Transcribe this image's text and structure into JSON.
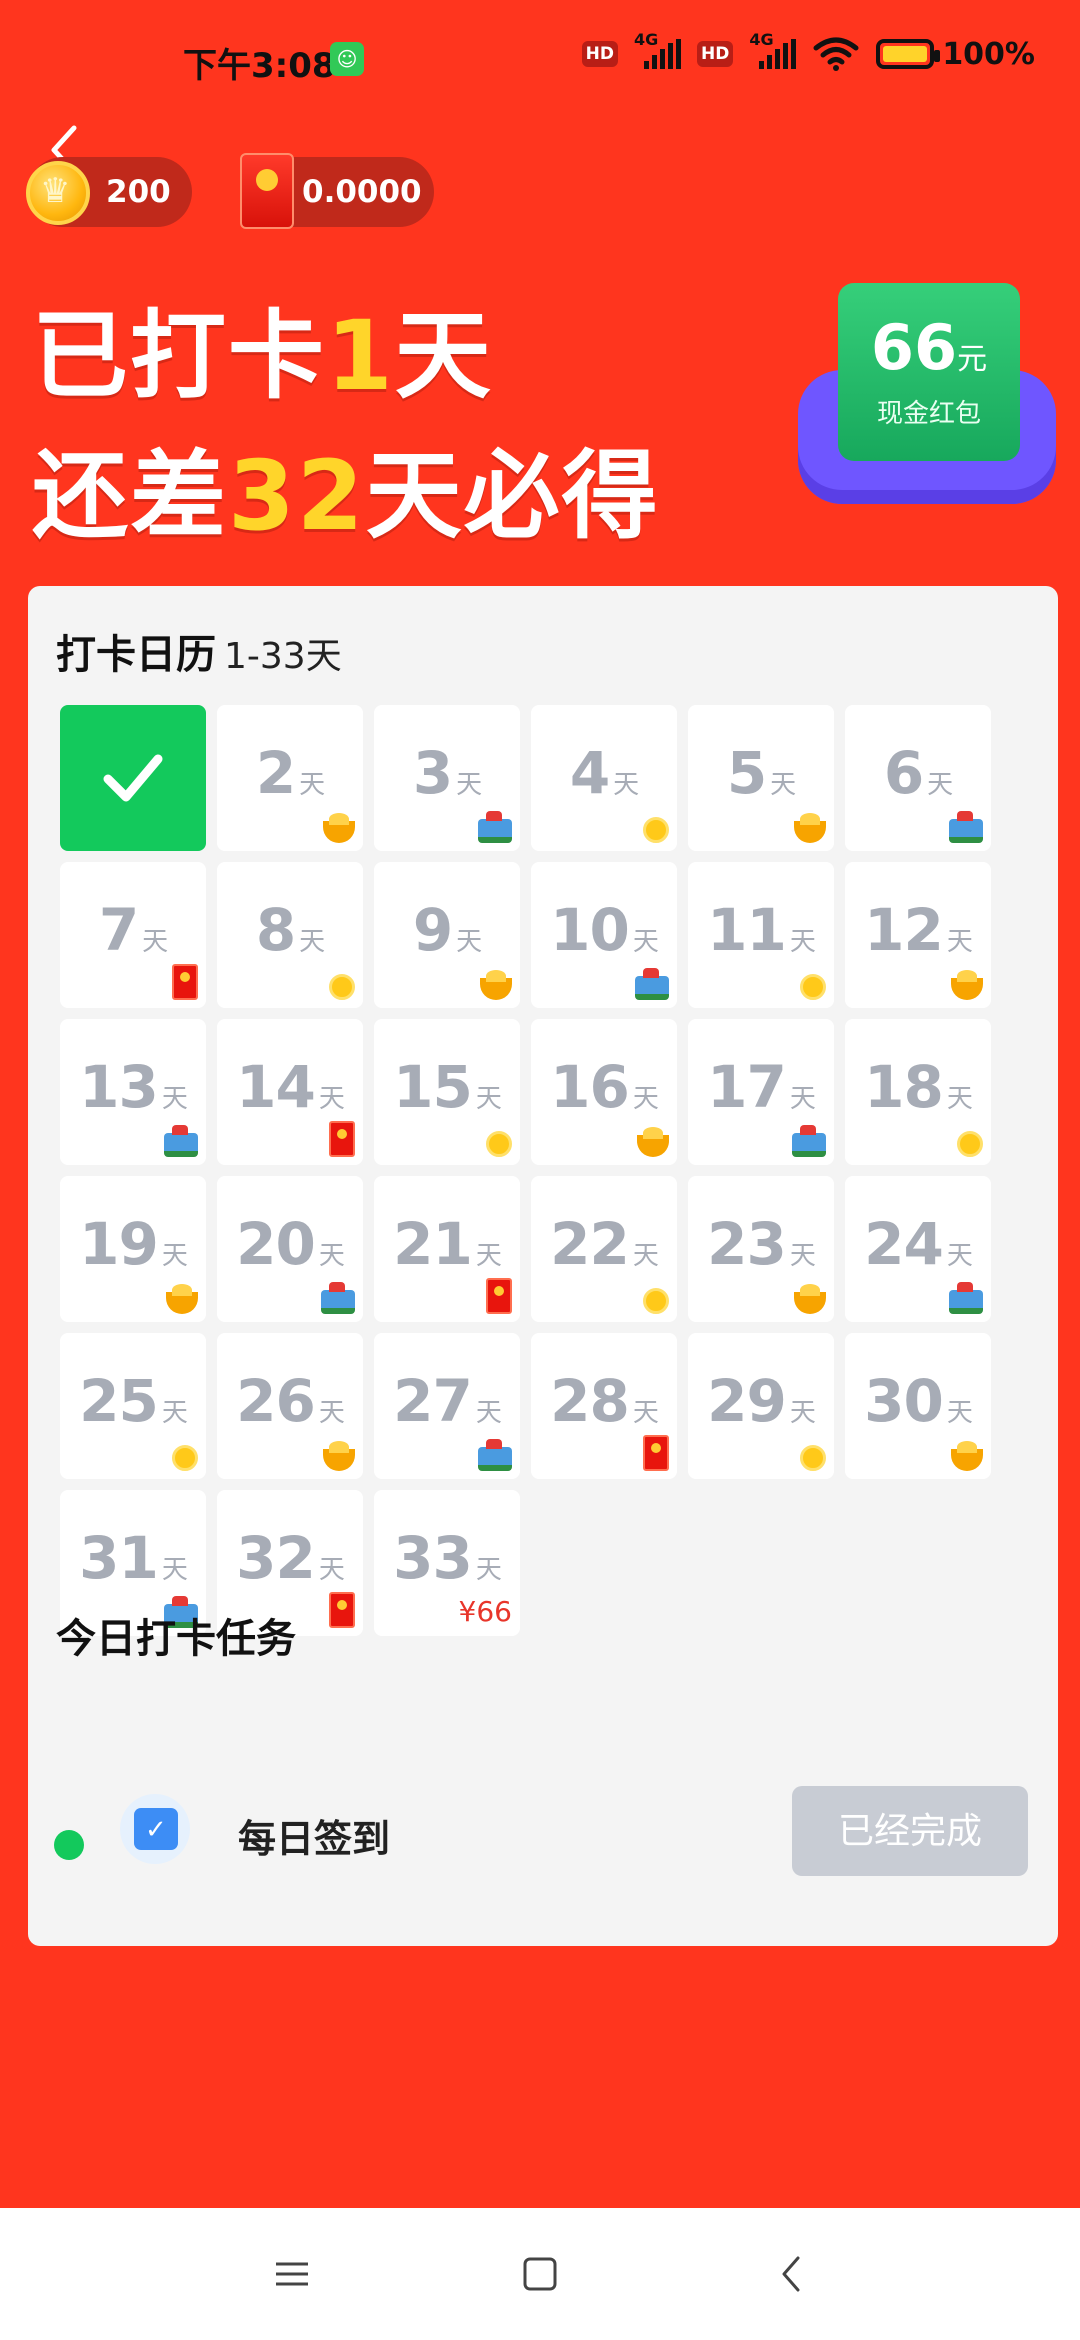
{
  "status_bar": {
    "time": "下午3:08",
    "hd1": "HD",
    "net1": "4G",
    "hd2": "HD",
    "net2": "4G",
    "battery": "100%"
  },
  "header": {
    "coins": "200",
    "cash": "0.0000"
  },
  "headline": {
    "line1_prefix": "已打卡",
    "line1_days": "1",
    "line1_suffix": "天",
    "line2_prefix": "还差",
    "line2_days": "32",
    "line2_suffix": "天必得"
  },
  "prize": {
    "amount": "66",
    "unit": "元",
    "label": "现金红包"
  },
  "calendar": {
    "title": "打卡日历",
    "range": "1-33天",
    "day_unit": "天",
    "days": [
      {
        "day": "1",
        "done": true,
        "reward": ""
      },
      {
        "day": "2",
        "reward": "ingot"
      },
      {
        "day": "3",
        "reward": "chest"
      },
      {
        "day": "4",
        "reward": "coin"
      },
      {
        "day": "5",
        "reward": "ingot"
      },
      {
        "day": "6",
        "reward": "chest"
      },
      {
        "day": "7",
        "reward": "envelope"
      },
      {
        "day": "8",
        "reward": "coin"
      },
      {
        "day": "9",
        "reward": "ingot"
      },
      {
        "day": "10",
        "reward": "chest"
      },
      {
        "day": "11",
        "reward": "coin"
      },
      {
        "day": "12",
        "reward": "ingot"
      },
      {
        "day": "13",
        "reward": "chest"
      },
      {
        "day": "14",
        "reward": "envelope"
      },
      {
        "day": "15",
        "reward": "coin"
      },
      {
        "day": "16",
        "reward": "ingot"
      },
      {
        "day": "17",
        "reward": "chest"
      },
      {
        "day": "18",
        "reward": "coin"
      },
      {
        "day": "19",
        "reward": "ingot"
      },
      {
        "day": "20",
        "reward": "chest"
      },
      {
        "day": "21",
        "reward": "envelope"
      },
      {
        "day": "22",
        "reward": "coin"
      },
      {
        "day": "23",
        "reward": "ingot"
      },
      {
        "day": "24",
        "reward": "chest"
      },
      {
        "day": "25",
        "reward": "coin"
      },
      {
        "day": "26",
        "reward": "ingot"
      },
      {
        "day": "27",
        "reward": "chest"
      },
      {
        "day": "28",
        "reward": "envelope"
      },
      {
        "day": "29",
        "reward": "coin"
      },
      {
        "day": "30",
        "reward": "ingot"
      },
      {
        "day": "31",
        "reward": "chest"
      },
      {
        "day": "32",
        "reward": "envelope"
      },
      {
        "day": "33",
        "reward": "text",
        "reward_text": "¥66"
      }
    ]
  },
  "task": {
    "section_title": "今日打卡任务",
    "name": "每日签到",
    "button": "已经完成"
  },
  "colors": {
    "background": "#ff351e",
    "highlight": "#ffd52a",
    "done_green": "#13c95c",
    "prize_green": "#1fba66",
    "prize_base": "#6f56ff"
  }
}
